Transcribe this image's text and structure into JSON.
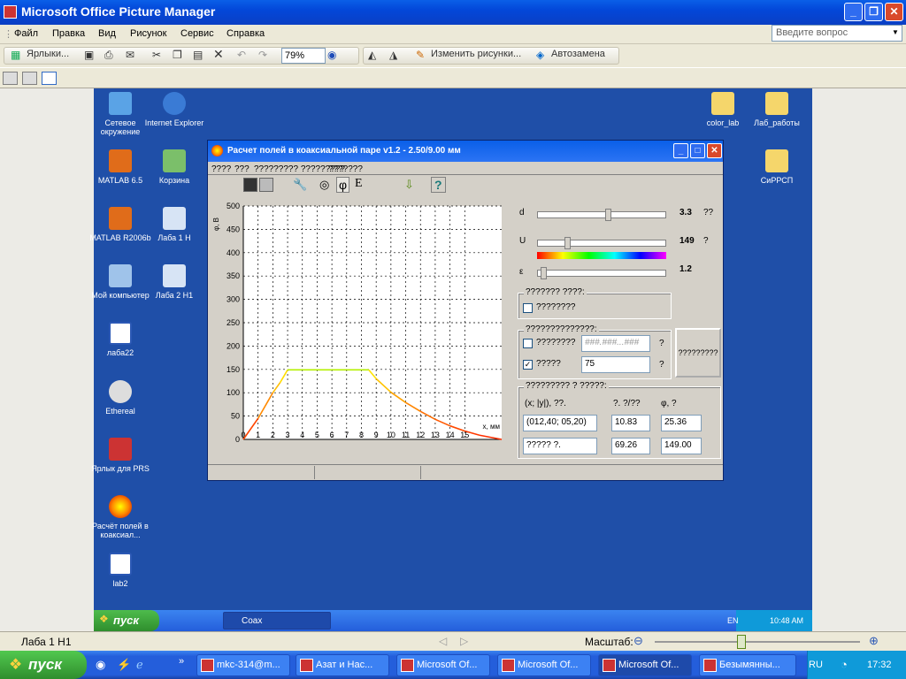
{
  "app": {
    "title": "Microsoft Office Picture Manager"
  },
  "menu": [
    "Файл",
    "Правка",
    "Вид",
    "Рисунок",
    "Сервис",
    "Справка"
  ],
  "ask_placeholder": "Введите вопрос",
  "toolbar": {
    "shortcuts": "Ярлыки...",
    "zoom": "79%",
    "edit_pictures": "Изменить рисунки...",
    "autocorrect": "Автозамена"
  },
  "desktop_icons": [
    {
      "label": "Сетевое окружение",
      "icon": "network-icon"
    },
    {
      "label": "Internet Explorer",
      "icon": "ie-icon"
    },
    {
      "label": "MATLAB 6.5",
      "icon": "matlab-icon"
    },
    {
      "label": "Корзина",
      "icon": "recycle-bin-icon"
    },
    {
      "label": "MATLAB R2006b",
      "icon": "matlab-icon"
    },
    {
      "label": "Лаба 1 Н",
      "icon": "shortcut-icon"
    },
    {
      "label": "Мой компьютер",
      "icon": "computer-icon"
    },
    {
      "label": "Лаба 2 Н1",
      "icon": "shortcut-icon"
    },
    {
      "label": "лаба22",
      "icon": "word-doc-icon"
    },
    {
      "label": "Ethereal",
      "icon": "ethereal-icon"
    },
    {
      "label": "Ярлык для PRS",
      "icon": "shortcut-icon"
    },
    {
      "label": "Расчёт полей в коаксиал...",
      "icon": "coax-icon"
    },
    {
      "label": "lab2",
      "icon": "word-doc-icon"
    },
    {
      "label": "color_lab",
      "icon": "folder-icon"
    },
    {
      "label": "Лаб_работы",
      "icon": "folder-icon"
    },
    {
      "label": "СиРРСП",
      "icon": "folder-icon"
    }
  ],
  "dialog": {
    "title": "Расчет полей в коаксиальной паре v1.2 - 2.50/9.00 мм",
    "menu": [
      "????",
      "???",
      "????????? ?????????",
      "???????"
    ],
    "toolbar_glyphs": {
      "phi": "φ",
      "e": "E",
      "help": "?"
    },
    "params": {
      "d": {
        "label": "d",
        "value": "3.3",
        "unit": "??",
        "level": 0.55
      },
      "u": {
        "label": "U",
        "value": "149",
        "unit": "?",
        "level": 0.22
      },
      "eps": {
        "label": "ε",
        "value": "1.2",
        "level": 0.02
      }
    },
    "group1": {
      "legend": "??????? ????:",
      "checkbox": "????????"
    },
    "group2": {
      "legend": "??????????????:",
      "row1_label": "????????",
      "row1_placeholder": "###.###...###",
      "row1_unit": "?",
      "row2_label": "?????",
      "row2_value": "75",
      "row2_unit": "?",
      "button": "?????????"
    },
    "group3": {
      "legend": "????????? ? ?????:",
      "col1": "(x; |y|), ??.",
      "col2": "?. ?/??",
      "col3": "φ, ?",
      "r1c1": "(012,40; 05,20)",
      "r1c2": "10.83",
      "r1c3": "25.36",
      "r2c1": "????? ?.",
      "r2c2": "69.26",
      "r2c3": "149.00"
    }
  },
  "chart_data": {
    "type": "line",
    "ylabel": "φ, В",
    "xlabel": "x, мм",
    "xticks": [
      0,
      1,
      2,
      3,
      4,
      5,
      6,
      7,
      8,
      9,
      10,
      11,
      12,
      13,
      14,
      15
    ],
    "yticks": [
      0,
      50,
      100,
      150,
      200,
      250,
      300,
      350,
      400,
      450,
      500
    ],
    "xlim": [
      0,
      17.5
    ],
    "ylim": [
      0,
      500
    ],
    "x": [
      0,
      1,
      2,
      2.5,
      3,
      4,
      5,
      6,
      7,
      8,
      8.5,
      9,
      10,
      11,
      12,
      13,
      14,
      15,
      16,
      17.5
    ],
    "y": [
      0,
      45,
      100,
      122,
      149,
      149,
      149,
      149,
      149,
      149,
      149,
      130,
      101,
      79,
      60,
      43,
      29,
      18,
      9,
      0
    ]
  },
  "inner_taskbar": {
    "start": "пуск",
    "window": "Coax",
    "lang": "EN",
    "time": "10:48 AM"
  },
  "status": {
    "left": "Лаба 1 Н1",
    "zoom_label": "Масштаб:",
    "zoom_level": 0.42
  },
  "taskbar": {
    "start": "пуск",
    "chevron": "»",
    "items": [
      "mkc-314@m...",
      "Азат и Нас...",
      "Microsoft Of...",
      "Microsoft Of...",
      "Microsoft Of...",
      "Безымянны..."
    ],
    "lang": "RU",
    "time": "17:32"
  }
}
